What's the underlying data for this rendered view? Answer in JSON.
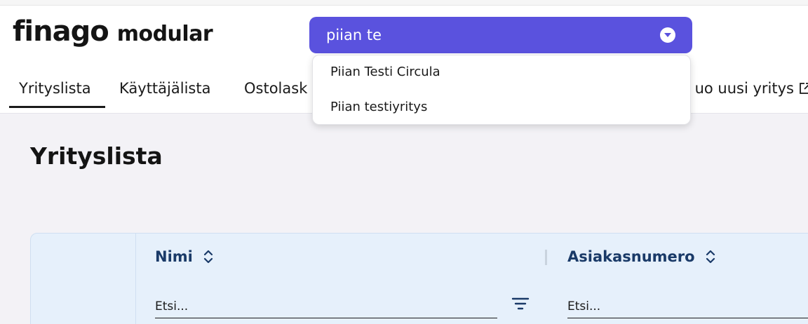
{
  "app": {
    "brand": "finago",
    "product": "modular"
  },
  "company_select": {
    "value": "piian te",
    "options": [
      "Piian Testi Circula",
      "Piian testiyritys"
    ]
  },
  "nav": {
    "tabs": [
      {
        "label": "Yrityslista",
        "active": true
      },
      {
        "label": "Käyttäjälista",
        "active": false
      },
      {
        "label": "Ostolask",
        "active": false
      }
    ],
    "create_company": "uo uusi yritys"
  },
  "page": {
    "title": "Yrityslista"
  },
  "table": {
    "columns": [
      {
        "header": "Nimi",
        "filter_placeholder": "Etsi..."
      },
      {
        "header": "Asiakasnumero",
        "filter_placeholder": "Etsi..."
      }
    ]
  },
  "colors": {
    "accent": "#5a52de",
    "table_header_bg": "#e6f0fb",
    "header_text": "#1a3a68"
  }
}
